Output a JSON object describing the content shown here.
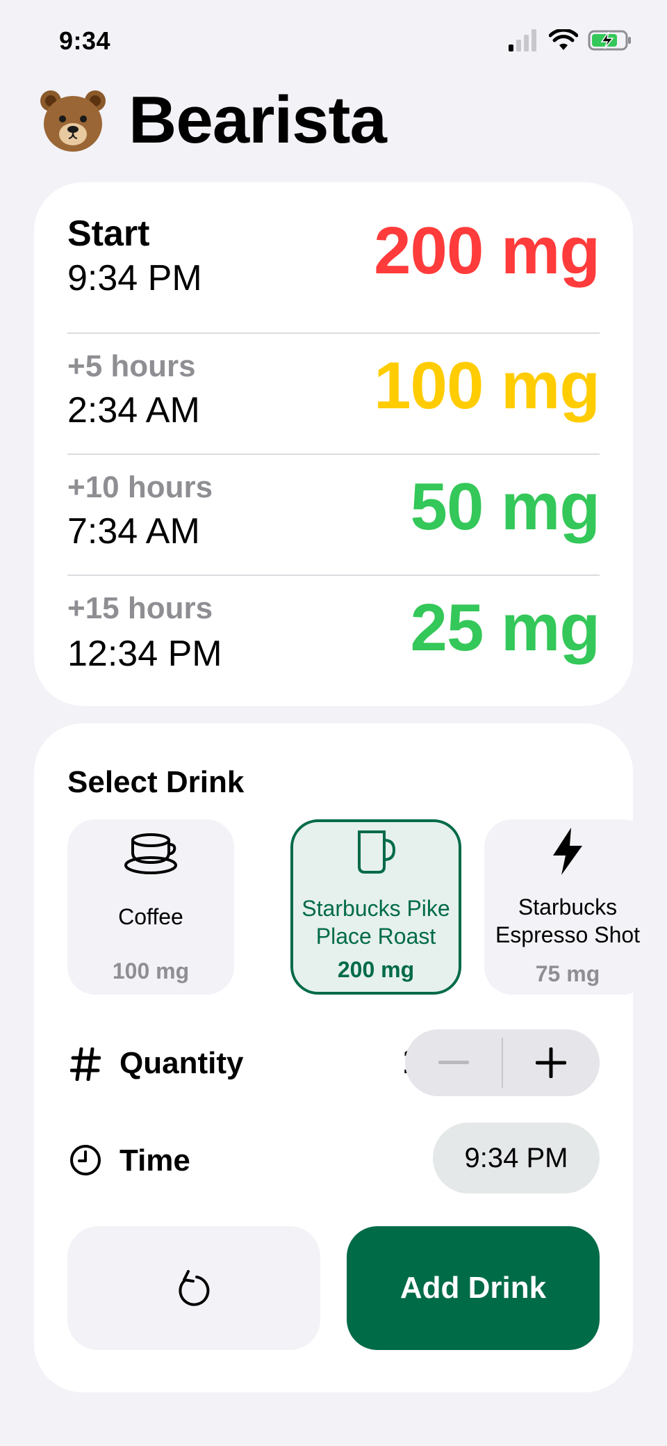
{
  "status_bar": {
    "time": "9:34"
  },
  "app": {
    "title": "Bearista"
  },
  "schedule": [
    {
      "label": "Start",
      "time": "9:34 PM",
      "amount": "200 mg",
      "color": "#ff3b3b"
    },
    {
      "label": "+5 hours",
      "time": "2:34 AM",
      "amount": "100 mg",
      "color": "#ffcc00"
    },
    {
      "label": "+10 hours",
      "time": "7:34 AM",
      "amount": "50 mg",
      "color": "#34c759"
    },
    {
      "label": "+15 hours",
      "time": "12:34 PM",
      "amount": "25 mg",
      "color": "#34c759"
    }
  ],
  "select_drink": {
    "title": "Select Drink",
    "drinks": [
      {
        "line1": "Coffee",
        "line2": "",
        "caffeine": "100 mg",
        "icon": "coffee-cup-icon",
        "selected": false
      },
      {
        "line1": "Starbucks Pike",
        "line2": "Place Roast",
        "caffeine": "200 mg",
        "icon": "mug-icon",
        "selected": true
      },
      {
        "line1": "Starbucks",
        "line2": "Espresso Shot",
        "caffeine": "75 mg",
        "icon": "bolt-icon",
        "selected": false
      }
    ]
  },
  "quantity": {
    "label": "Quantity",
    "value": "1"
  },
  "time": {
    "label": "Time",
    "value": "9:34 PM"
  },
  "actions": {
    "add_label": "Add Drink"
  },
  "colors": {
    "accent": "#006b47",
    "selected_bg": "#e6f0ec"
  }
}
